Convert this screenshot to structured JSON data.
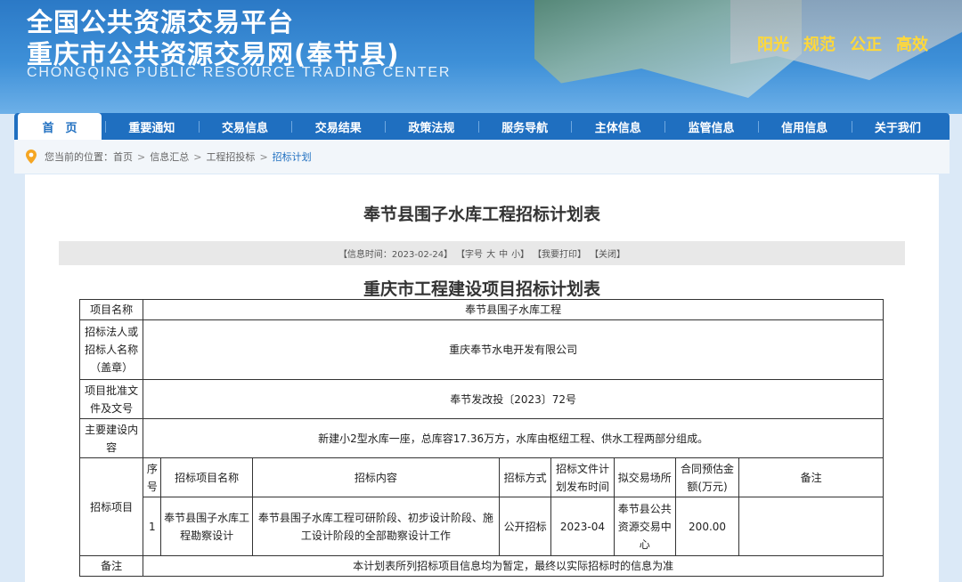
{
  "header": {
    "title_line1": "全国公共资源交易平台",
    "title_line2": "重庆市公共资源交易网(奉节县)",
    "title_en": "CHONGQING PUBLIC RESOURCE TRADING CENTER",
    "slogans": [
      "阳光",
      "规范",
      "公正",
      "高效"
    ]
  },
  "nav": {
    "items": [
      "首　页",
      "重要通知",
      "交易信息",
      "交易结果",
      "政策法规",
      "服务导航",
      "主体信息",
      "监管信息",
      "信用信息",
      "关于我们"
    ]
  },
  "breadcrumb": {
    "prefix": "您当前的位置：",
    "items": [
      "首页",
      "信息汇总",
      "工程招投标",
      "招标计划"
    ]
  },
  "article": {
    "title": "奉节县围子水库工程招标计划表",
    "meta": {
      "time": "【信息时间：2023-02-24】",
      "font_prefix": "【字号",
      "font_large": "大",
      "font_medium": "中",
      "font_small": "小】",
      "print": "【我要打印】",
      "close": "【关闭】"
    }
  },
  "table": {
    "title": "重庆市工程建设项目招标计划表",
    "project_name_label": "项目名称",
    "project_name": "奉节县围子水库工程",
    "tenderer_label": "招标法人或招标人名称（盖章）",
    "tenderer": "重庆奉节水电开发有限公司",
    "approval_label": "项目批准文件及文号",
    "approval": "奉节发改投〔2023〕72号",
    "content_label": "主要建设内容",
    "content": "新建小2型水库一座，总库容17.36万方，水库由枢纽工程、供水工程两部分组成。",
    "items_label": "招标项目",
    "columns": [
      "序号",
      "招标项目名称",
      "招标内容",
      "招标方式",
      "招标文件计划发布时间",
      "拟交易场所",
      "合同预估金额(万元)",
      "备注"
    ],
    "rows": [
      {
        "no": "1",
        "name": "奉节县围子水库工程勘察设计",
        "content": "奉节县围子水库工程可研阶段、初步设计阶段、施工设计阶段的全部勘察设计工作",
        "method": "公开招标",
        "time": "2023-04",
        "place": "奉节县公共资源交易中心",
        "amount": "200.00",
        "remark": ""
      }
    ],
    "note_label": "备注",
    "note": "本计划表所列招标项目信息均为暂定，最终以实际招标时的信息为准"
  }
}
